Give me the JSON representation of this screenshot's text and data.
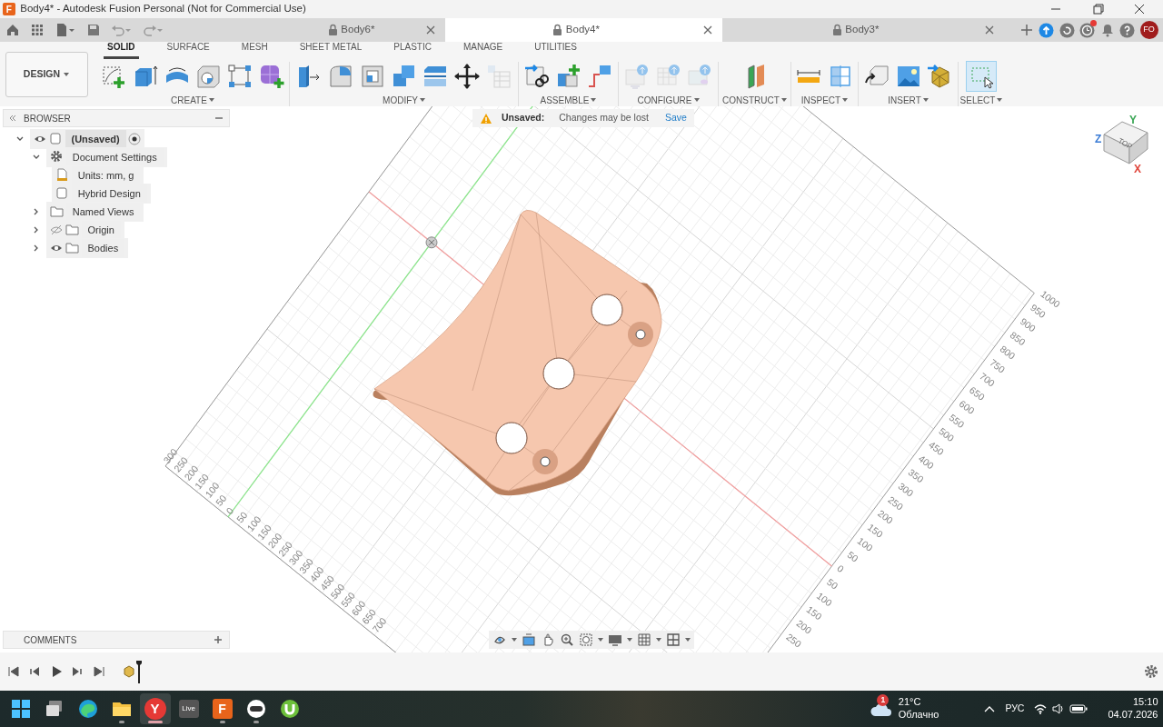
{
  "window": {
    "title": "Body4* - Autodesk Fusion Personal (Not for Commercial Use)",
    "app_glyph": "F"
  },
  "document_tabs": [
    {
      "label": "Body6*",
      "selected": false
    },
    {
      "label": "Body4*",
      "selected": true
    },
    {
      "label": "Body3*",
      "selected": false
    }
  ],
  "job_status": {
    "alert": true
  },
  "user": {
    "initials": "FO"
  },
  "workspace": {
    "label": "DESIGN"
  },
  "toolbar_tabs": [
    {
      "label": "SOLID",
      "selected": true
    },
    {
      "label": "SURFACE",
      "selected": false
    },
    {
      "label": "MESH",
      "selected": false
    },
    {
      "label": "SHEET METAL",
      "selected": false
    },
    {
      "label": "PLASTIC",
      "selected": false
    },
    {
      "label": "MANAGE",
      "selected": false
    },
    {
      "label": "UTILITIES",
      "selected": false
    }
  ],
  "tool_groups": [
    {
      "label": "CREATE",
      "tools": [
        {
          "enabled": true,
          "active": false
        },
        {
          "enabled": true,
          "active": false
        },
        {
          "enabled": true,
          "active": false
        },
        {
          "enabled": true,
          "active": false
        },
        {
          "enabled": true,
          "active": false
        },
        {
          "enabled": true,
          "active": false
        }
      ]
    },
    {
      "label": "MODIFY",
      "tools": [
        {
          "enabled": true,
          "active": false
        },
        {
          "enabled": true,
          "active": false
        },
        {
          "enabled": true,
          "active": false
        },
        {
          "enabled": true,
          "active": false
        },
        {
          "enabled": true,
          "active": false
        },
        {
          "enabled": true,
          "active": false
        },
        {
          "enabled": false,
          "active": false
        }
      ]
    },
    {
      "label": "ASSEMBLE",
      "tools": [
        {
          "enabled": true,
          "active": false
        },
        {
          "enabled": true,
          "active": false
        },
        {
          "enabled": true,
          "active": false
        }
      ]
    },
    {
      "label": "CONFIGURE",
      "tools": [
        {
          "enabled": false,
          "active": false
        },
        {
          "enabled": false,
          "active": false
        },
        {
          "enabled": false,
          "active": false
        }
      ]
    },
    {
      "label": "CONSTRUCT",
      "tools": [
        {
          "enabled": true,
          "active": false
        }
      ]
    },
    {
      "label": "INSPECT",
      "tools": [
        {
          "enabled": true,
          "active": false
        },
        {
          "enabled": true,
          "active": false
        }
      ]
    },
    {
      "label": "INSERT",
      "tools": [
        {
          "enabled": true,
          "active": false
        },
        {
          "enabled": true,
          "active": false
        },
        {
          "enabled": true,
          "active": false
        }
      ]
    },
    {
      "label": "SELECT",
      "tools": [
        {
          "enabled": true,
          "active": true
        }
      ]
    }
  ],
  "browser": {
    "title": "BROWSER",
    "tree": [
      {
        "label": "(Unsaved)",
        "kind": "component",
        "expanded": true,
        "visible": true,
        "active": true,
        "children": [
          {
            "label": "Document Settings",
            "kind": "settings",
            "expanded": true,
            "children": [
              {
                "label": "Units: mm, g",
                "kind": "units"
              },
              {
                "label": "Hybrid Design",
                "kind": "design"
              }
            ]
          },
          {
            "label": "Named Views",
            "kind": "folder",
            "expanded": false
          },
          {
            "label": "Origin",
            "kind": "folder",
            "expanded": false,
            "visible": false
          },
          {
            "label": "Bodies",
            "kind": "folder",
            "expanded": false,
            "visible": true
          }
        ]
      }
    ]
  },
  "banner": {
    "label": "Unsaved:",
    "message": "Changes may be lost",
    "action": "Save"
  },
  "viewcube": {
    "face": "TOP",
    "axes": [
      {
        "label": "Y",
        "color": "#3aa655"
      },
      {
        "label": "Z",
        "color": "#3a7bd5"
      },
      {
        "label": "X",
        "color": "#e0443a"
      }
    ]
  },
  "grid_labels": {
    "front_edge": [
      "300",
      "250",
      "200",
      "150",
      "100",
      "50",
      "0",
      "50",
      "100",
      "150",
      "200",
      "250",
      "300",
      "350",
      "400",
      "450",
      "500",
      "550",
      "600",
      "650",
      "700"
    ],
    "side_edge": [
      "250",
      "200",
      "150",
      "100",
      "50",
      "0",
      "50",
      "100",
      "150",
      "200",
      "250",
      "300",
      "350",
      "400",
      "450",
      "500",
      "550",
      "600",
      "650",
      "700",
      "750",
      "800",
      "850",
      "900",
      "950",
      "1000"
    ]
  },
  "comments": {
    "title": "COMMENTS"
  },
  "taskbar": {
    "apps": [
      {
        "kind": "start",
        "running": false,
        "active": false
      },
      {
        "kind": "task_view",
        "running": false,
        "active": false
      },
      {
        "kind": "browser",
        "running": false,
        "active": false
      },
      {
        "kind": "folder",
        "running": true,
        "active": false
      },
      {
        "kind": "yandex",
        "glyph": "Y",
        "running": true,
        "active": true
      },
      {
        "kind": "live",
        "glyph": "Live",
        "running": false,
        "active": false
      },
      {
        "kind": "fusion",
        "glyph": "F",
        "running": true,
        "active": false
      },
      {
        "kind": "game",
        "running": true,
        "active": false
      },
      {
        "kind": "torrent",
        "running": false,
        "active": false
      }
    ]
  },
  "weather": {
    "badge": "1",
    "temperature": "21°C",
    "condition": "Облачно"
  },
  "tray": {
    "language": "РУС"
  },
  "clock": {
    "time": "15:10",
    "date": "04.07.2026"
  }
}
